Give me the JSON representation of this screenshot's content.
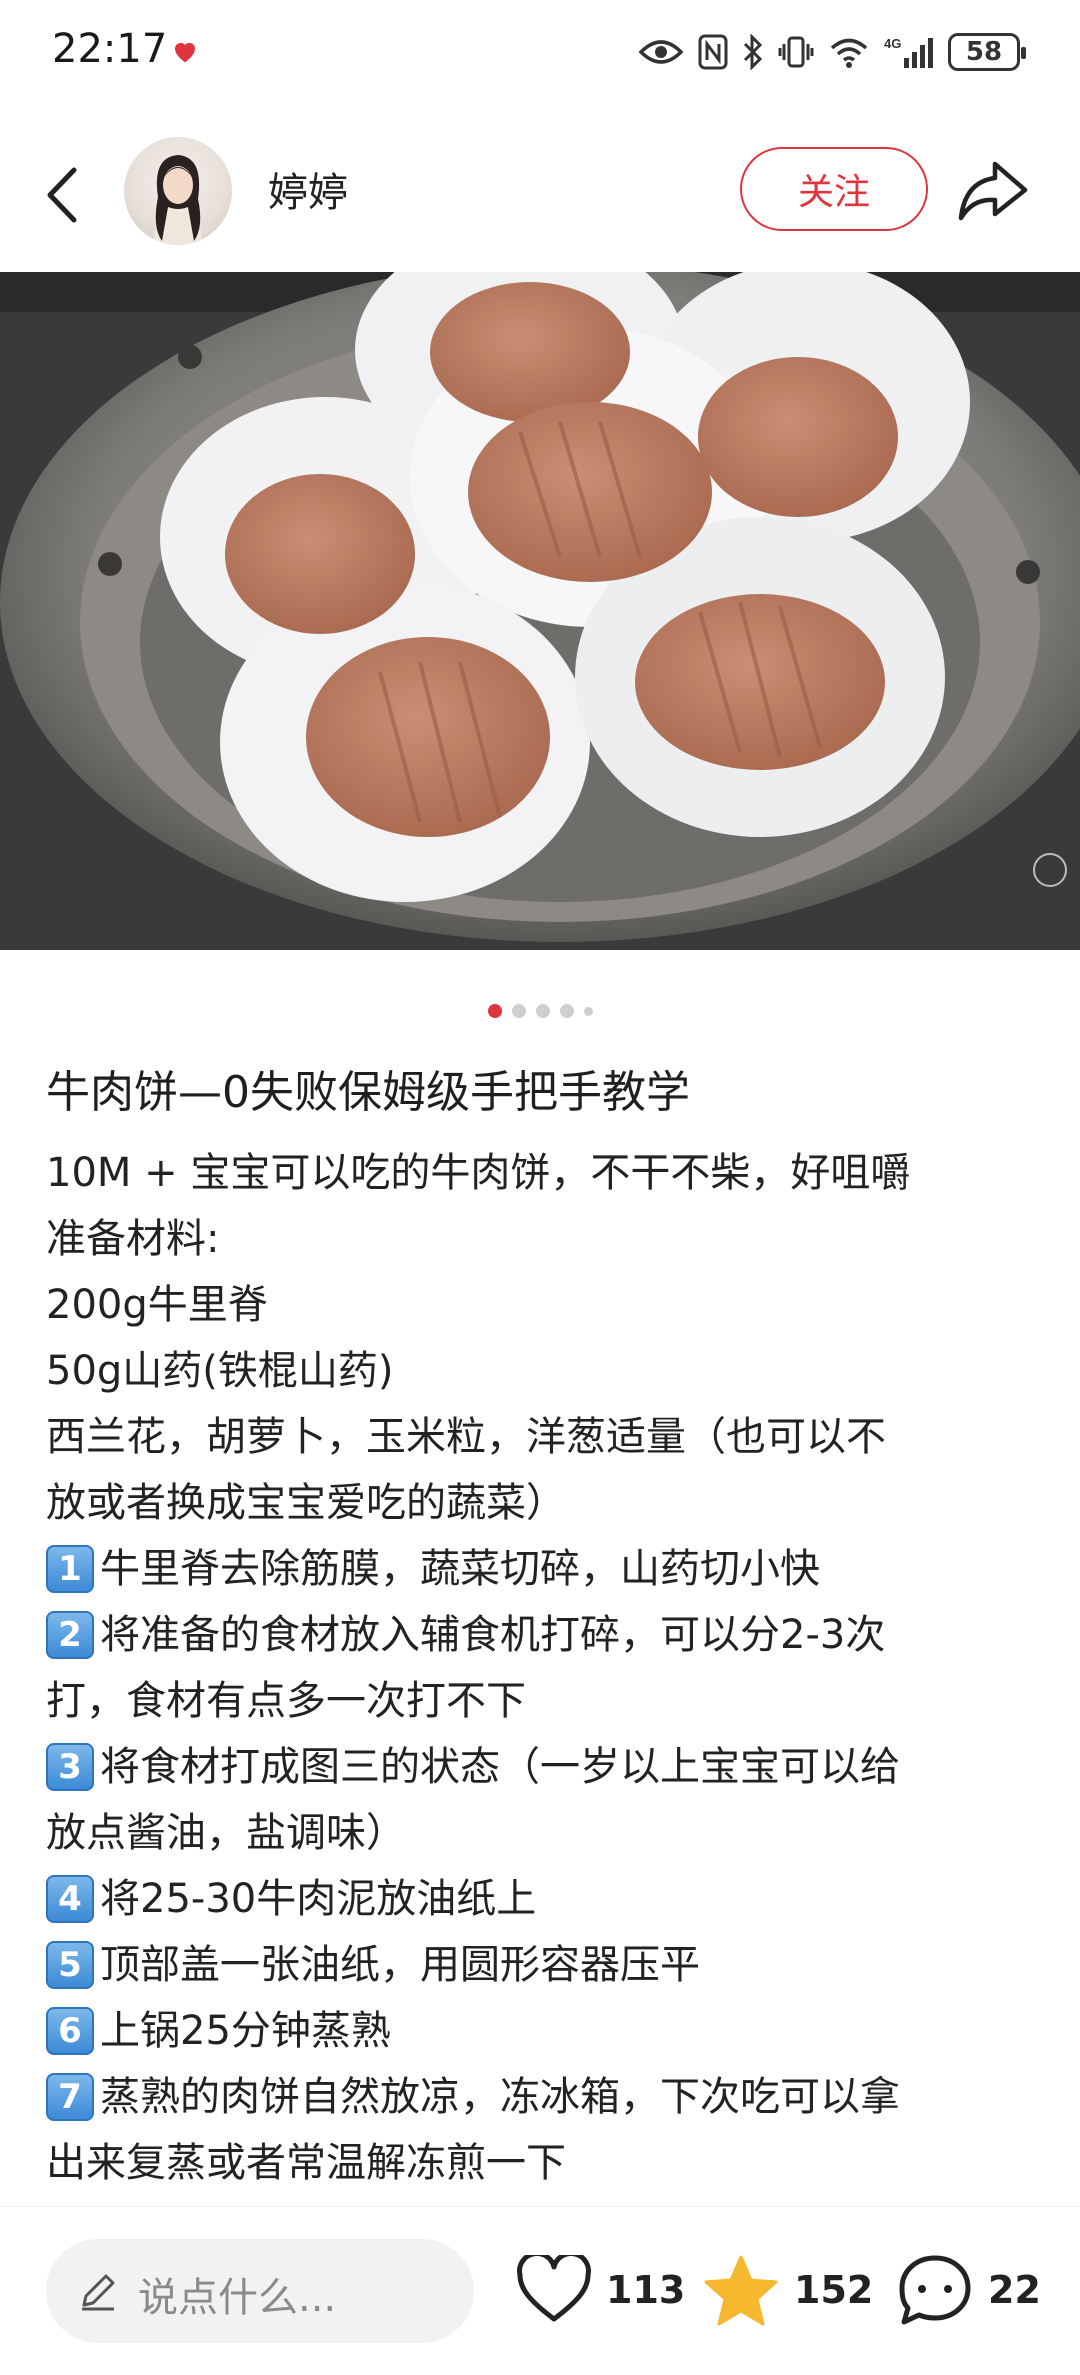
{
  "status_bar": {
    "time": "22:17",
    "battery": "58",
    "icons": [
      "heart-icon",
      "eye-icon",
      "nfc-icon",
      "bluetooth-icon",
      "vibrate-icon",
      "wifi-icon",
      "signal-4g-icon",
      "battery-icon"
    ]
  },
  "header": {
    "username": "婷婷",
    "follow_label": "关注",
    "icons": [
      "back-arrow-icon",
      "share-icon"
    ]
  },
  "carousel": {
    "total_dots": 5,
    "active_index": 0
  },
  "post": {
    "title": "牛肉饼—0失败保姆级手把手教学",
    "lines": [
      {
        "num": "",
        "text": "10M + 宝宝可以吃的牛肉饼，不干不柴，好咀嚼"
      },
      {
        "num": "",
        "text": "准备材料:"
      },
      {
        "num": "",
        "text": "200g牛里脊"
      },
      {
        "num": "",
        "text": "50g山药(铁棍山药)"
      },
      {
        "num": "",
        "text": "西兰花，胡萝卜，玉米粒，洋葱适量（也可以不"
      },
      {
        "num": "",
        "text": "放或者换成宝宝爱吃的蔬菜）"
      },
      {
        "num": "1",
        "text": "牛里脊去除筋膜，蔬菜切碎，山药切小快"
      },
      {
        "num": "2",
        "text": "将准备的食材放入辅食机打碎，可以分2-3次"
      },
      {
        "num": "",
        "text": "打，食材有点多一次打不下"
      },
      {
        "num": "3",
        "text": "将食材打成图三的状态（一岁以上宝宝可以给"
      },
      {
        "num": "",
        "text": "放点酱油，盐调味）"
      },
      {
        "num": "4",
        "text": "将25-30牛肉泥放油纸上"
      },
      {
        "num": "5",
        "text": "顶部盖一张油纸，用圆形容器压平"
      },
      {
        "num": "6",
        "text": "上锅25分钟蒸熟"
      },
      {
        "num": "7",
        "text": "蒸熟的肉饼自然放凉，冻冰箱，下次吃可以拿"
      },
      {
        "num": "",
        "text": "出来复蒸或者常温解冻煎一下"
      }
    ]
  },
  "bottom_bar": {
    "comment_placeholder": "说点什么...",
    "likes": "113",
    "favorites": "152",
    "comments": "22"
  },
  "colors": {
    "accent": "#e0353e",
    "star": "#f5b82e",
    "number_badge": "#3c8ad6"
  }
}
